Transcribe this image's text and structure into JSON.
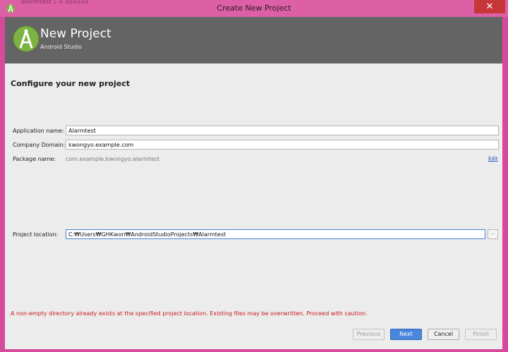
{
  "window": {
    "title": "Create New Project",
    "close_symbol": "✕",
    "background_tab_text": "ɑlɑrmtest  ʟ  ʜ ɢɢɢɢɢɢ"
  },
  "banner": {
    "title": "New Project",
    "subtitle": "Android Studio",
    "logo_icon": "android-studio-logo-icon"
  },
  "section_title": "Configure your new project",
  "form": {
    "application_name_label": "Application name:",
    "application_name_value": "Alarmtest",
    "company_domain_label": "Company Domain:",
    "company_domain_value": "kwongyo.example.com",
    "package_name_label": "Package name:",
    "package_name_value": "com.example.kwongyo.alarmtest",
    "edit_link": "Edit",
    "project_location_label": "Project location:",
    "project_location_value": "C:₩Users₩GHKwon₩AndroidStudioProjects₩Alarmtest",
    "browse_label": "..."
  },
  "warning": "A non-empty directory already exists at the specified project location. Existing files may be overwritten. Proceed with caution.",
  "buttons": {
    "previous": "Previous",
    "next": "Next",
    "cancel": "Cancel",
    "finish": "Finish"
  },
  "colors": {
    "window_frame": "#d54a9c",
    "banner": "#646464",
    "warning_text": "#c8191f",
    "primary_button": "#4b86dd",
    "link": "#1f58c2"
  }
}
